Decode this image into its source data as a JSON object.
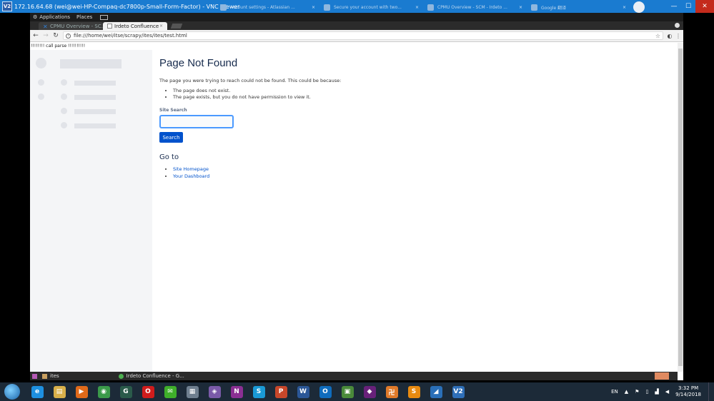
{
  "vnc": {
    "title": "172.16.64.68 (wei@wei-HP-Compaq-dc7800p-Small-Form-Factor) - VNC Viewer",
    "logo": "V2",
    "host_tabs": [
      {
        "label": "Account settings - Atlassian ...",
        "close": "×"
      },
      {
        "label": "Secure your account with two...",
        "close": "×"
      },
      {
        "label": "CPMU Overview - SCM - Irdeto ...",
        "close": "×"
      },
      {
        "label": "Google 翻译",
        "close": "×"
      }
    ],
    "window_controls": {
      "minimize": "—",
      "maximize": "☐",
      "close": "✕"
    }
  },
  "gnome": {
    "applications": "Applications",
    "places": "Places"
  },
  "browser": {
    "tabs": [
      {
        "label": "CPMU Overview - SC...",
        "close": "×",
        "active": false
      },
      {
        "label": "Irdeto Confluence",
        "close": "×",
        "active": true
      }
    ],
    "url": "file:///home/wei/itse/scrapy/ites/ites/test.html"
  },
  "page": {
    "debug_text": "!!!!!!!! call parse !!!!!!!!!!",
    "title": "Page Not Found",
    "intro": "The page you were trying to reach could not be found. This could be because:",
    "reasons": [
      "The page does not exist.",
      "The page exists, but you do not have permission to view it."
    ],
    "search_label": "Site Search",
    "search_value": "",
    "search_button": "Search",
    "goto_title": "Go to",
    "goto_links": [
      "Site Homepage",
      "Your Dashboard"
    ]
  },
  "remote_taskbar": {
    "items": [
      "ites",
      "Irdeto Confluence - G..."
    ]
  },
  "win_taskbar": {
    "apps": [
      {
        "name": "internet-explorer",
        "glyph": "e",
        "color": "#1e90e0"
      },
      {
        "name": "file-explorer",
        "glyph": "▤",
        "color": "#d8b04a"
      },
      {
        "name": "media-player",
        "glyph": "▶",
        "color": "#e06a1a"
      },
      {
        "name": "chrome",
        "glyph": "◉",
        "color": "#3b9a4a"
      },
      {
        "name": "app-terminal",
        "glyph": "G",
        "color": "#2a5a4a"
      },
      {
        "name": "opera",
        "glyph": "O",
        "color": "#d01c1c"
      },
      {
        "name": "wechat",
        "glyph": "✉",
        "color": "#3fae2a"
      },
      {
        "name": "calculator",
        "glyph": "▦",
        "color": "#6f7f8f"
      },
      {
        "name": "visual-studio-code",
        "glyph": "◈",
        "color": "#7a5aa8"
      },
      {
        "name": "onenote",
        "glyph": "N",
        "color": "#8b2f93"
      },
      {
        "name": "skype",
        "glyph": "S",
        "color": "#1a9ad6"
      },
      {
        "name": "powerpoint",
        "glyph": "P",
        "color": "#c8472a"
      },
      {
        "name": "word",
        "glyph": "W",
        "color": "#2b5797"
      },
      {
        "name": "outlook",
        "glyph": "O",
        "color": "#0f6cbd"
      },
      {
        "name": "image-viewer",
        "glyph": "▣",
        "color": "#4a8a3a"
      },
      {
        "name": "visual-studio",
        "glyph": "◆",
        "color": "#68217a"
      },
      {
        "name": "app-orange",
        "glyph": "卍",
        "color": "#e07a2a"
      },
      {
        "name": "sublime-text",
        "glyph": "S",
        "color": "#e88a10"
      },
      {
        "name": "app-blue",
        "glyph": "◢",
        "color": "#2a6fb8"
      },
      {
        "name": "vnc-viewer",
        "glyph": "V2",
        "color": "#2f6fb8"
      }
    ],
    "lang": "EN",
    "time": "3:32 PM",
    "date": "9/14/2018"
  }
}
